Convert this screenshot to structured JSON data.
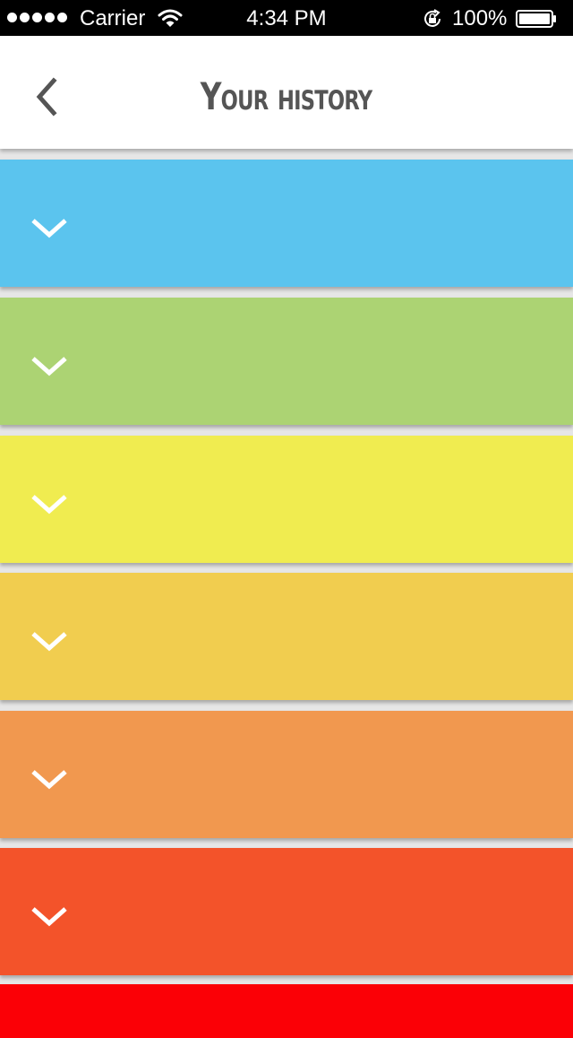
{
  "status_bar": {
    "carrier": "Carrier",
    "time": "4:34 PM",
    "battery_percent": "100%",
    "signal_bars": 5,
    "icons": [
      "signal-dots",
      "wifi-icon",
      "rotation-lock-icon",
      "battery-icon"
    ]
  },
  "header": {
    "title": "Your history",
    "back_icon": "chevron-left-icon"
  },
  "rows": [
    {
      "color": "#5bc4ee",
      "icon": "chevron-down-icon"
    },
    {
      "color": "#acd373",
      "icon": "chevron-down-icon"
    },
    {
      "color": "#f0ec50",
      "icon": "chevron-down-icon"
    },
    {
      "color": "#f1cd4f",
      "icon": "chevron-down-icon"
    },
    {
      "color": "#f1984f",
      "icon": "chevron-down-icon"
    },
    {
      "color": "#f3532a",
      "icon": "chevron-down-icon"
    },
    {
      "color": "#fb0006",
      "icon": ""
    }
  ],
  "colors": {
    "status_bar_bg": "#000000",
    "header_bg": "#ffffff",
    "title_color": "#555555",
    "chevron_color": "#ffffff"
  }
}
